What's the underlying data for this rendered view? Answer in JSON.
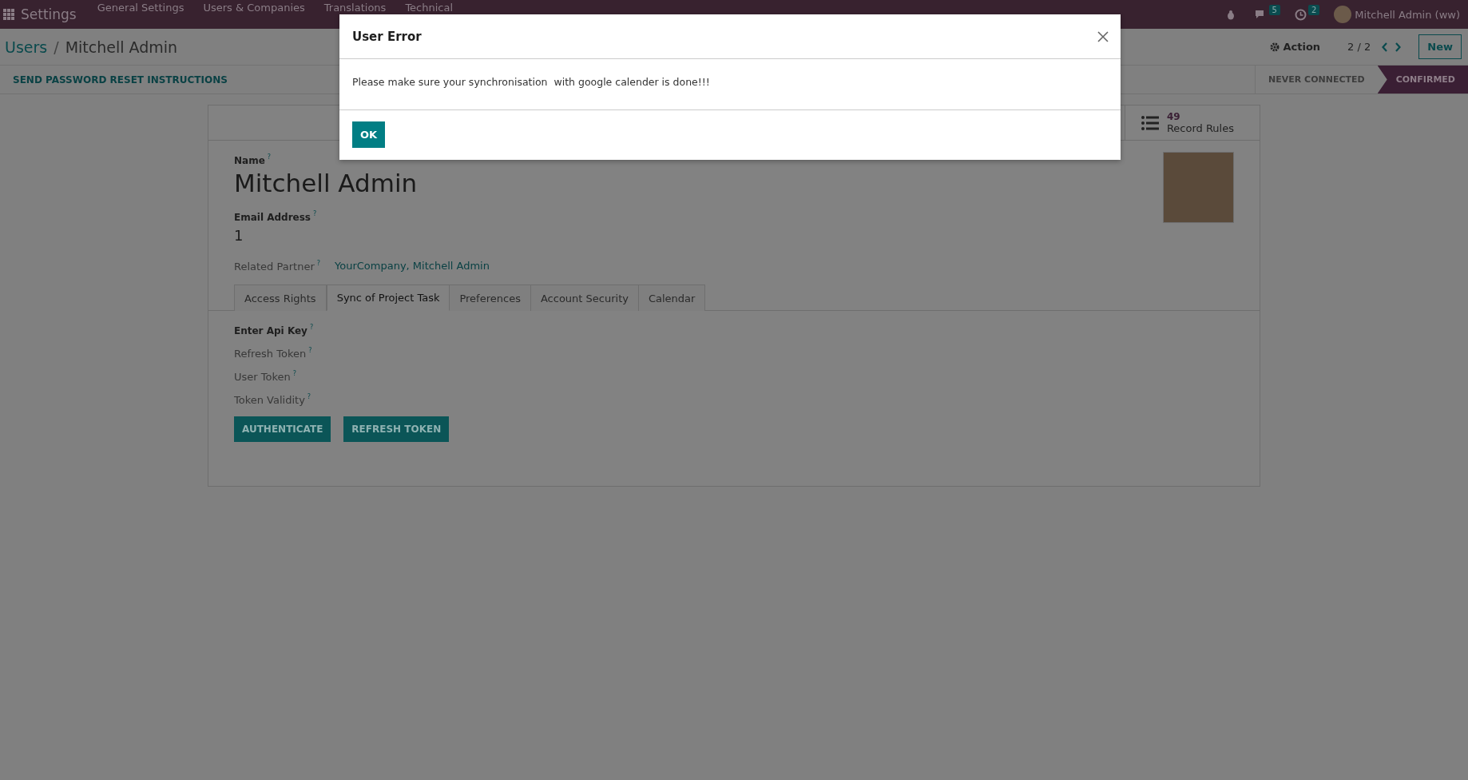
{
  "navbar": {
    "app": "Settings",
    "menus": [
      "General Settings",
      "Users & Companies",
      "Translations",
      "Technical"
    ],
    "chat_count": "5",
    "activity_count": "2",
    "user": "Mitchell Admin (ww)"
  },
  "control_panel": {
    "breadcrumb": [
      {
        "label": "Users",
        "link": true
      },
      {
        "label": "Mitchell Admin",
        "link": false
      }
    ],
    "separator": "/",
    "action": "Action",
    "pager": "2 / 2",
    "new": "New"
  },
  "status_bar": {
    "button": "SEND PASSWORD RESET INSTRUCTIONS",
    "stages": [
      {
        "label": "NEVER CONNECTED",
        "selected": false
      },
      {
        "label": "CONFIRMED",
        "selected": true
      }
    ]
  },
  "smart_button": {
    "count": "49",
    "label": "Record Rules"
  },
  "form": {
    "help": "?",
    "name_label": "Name",
    "name": "Mitchell Admin",
    "email_label": "Email Address",
    "email": "1",
    "partner_label": "Related Partner",
    "partner": "YourCompany, Mitchell Admin",
    "tabs": [
      {
        "label": "Access Rights",
        "selected": false
      },
      {
        "label": "Sync of Project Task",
        "selected": true
      },
      {
        "label": "Preferences",
        "selected": false
      },
      {
        "label": "Account Security",
        "selected": false
      },
      {
        "label": "Calendar",
        "selected": false
      }
    ],
    "api_key_label": "Enter Api Key",
    "fields": [
      "Refresh Token",
      "User Token",
      "Token Validity"
    ],
    "buttons": [
      "AUTHENTICATE",
      "REFRESH TOKEN"
    ]
  },
  "dialog": {
    "title": "User Error",
    "message": "Please make sure your synchronisation  with google calender is done!!!",
    "ok": "OK"
  }
}
